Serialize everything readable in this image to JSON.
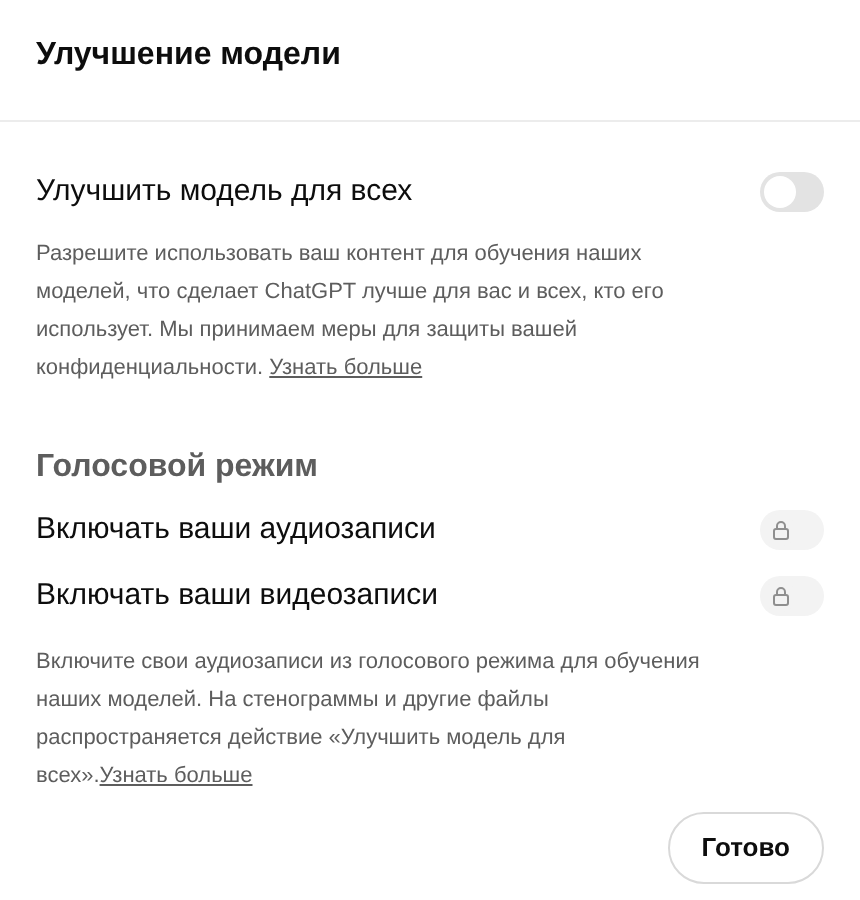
{
  "title": "Улучшение модели",
  "main_setting": {
    "label": "Улучшить модель для всех",
    "on": false,
    "locked": false,
    "description": "Разрешите использовать ваш контент для обучения наших моделей, что сделает ChatGPT лучше для вас и всех, кто его использует. Мы принимаем меры для защиты вашей конфиденциальности.",
    "link": "Узнать больше",
    "link_gap": true
  },
  "voice_section": {
    "heading": "Голосовой режим",
    "settings": [
      {
        "label": "Включать ваши аудиозаписи",
        "on": false,
        "locked": true
      },
      {
        "label": "Включать ваши видеозаписи",
        "on": false,
        "locked": true
      }
    ],
    "description": "Включите свои аудиозаписи из голосового режима для обучения наших моделей. На стенограммы и другие файлы распространяется действие «Улучшить модель для всех».",
    "link": "Узнать больше",
    "link_gap": false
  },
  "done_button": "Готово"
}
